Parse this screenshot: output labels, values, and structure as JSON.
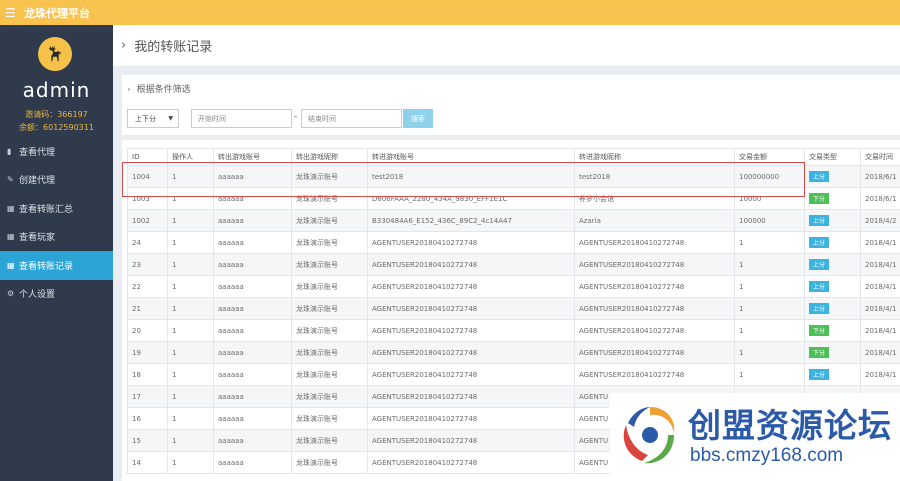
{
  "header": {
    "brand": "龙珠代理平台"
  },
  "sidebar": {
    "username": "admin",
    "invite_code": "邀请码：366197",
    "balance": "余额：6012590311",
    "items": [
      {
        "label": "查看代理",
        "icon": "book-icon",
        "glyph": "▮"
      },
      {
        "label": "创建代理",
        "icon": "edit-icon",
        "glyph": "✎"
      },
      {
        "label": "查看转账汇总",
        "icon": "table-icon",
        "glyph": "▦"
      },
      {
        "label": "查看玩家",
        "icon": "table-icon",
        "glyph": "▦"
      },
      {
        "label": "查看转账记录",
        "icon": "table-icon",
        "glyph": "▦",
        "active": true
      },
      {
        "label": "个人设置",
        "icon": "gear-icon",
        "glyph": "⚙"
      }
    ]
  },
  "page": {
    "title": "我的转账记录"
  },
  "filter": {
    "title": "根据条件筛选",
    "type_selected": "上下分",
    "start_placeholder": "开始时间",
    "separator": "-",
    "end_placeholder": "结束时间",
    "search_label": "搜索"
  },
  "table": {
    "columns": [
      "ID",
      "操作人",
      "转出游戏账号",
      "转出游戏昵称",
      "转进游戏账号",
      "转进游戏昵称",
      "交易金额",
      "交易类型",
      "交易时间"
    ],
    "rows": [
      {
        "id": "1004",
        "operator": "1",
        "from_account": "aaaaaa",
        "from_nick": "龙珠演示账号",
        "to_account": "test2018",
        "to_nick": "test2018",
        "amount": "100000000",
        "type": "上分",
        "time": "2018/6/1"
      },
      {
        "id": "1003",
        "operator": "1",
        "from_account": "aaaaaa",
        "from_nick": "龙珠演示账号",
        "to_account": "D806FAAA_2280_434A_9830_EFF1E1C",
        "to_nick": "养梦小会馆",
        "amount": "10000",
        "type": "下分",
        "time": "2018/6/1"
      },
      {
        "id": "1002",
        "operator": "1",
        "from_account": "aaaaaa",
        "from_nick": "龙珠演示账号",
        "to_account": "B330484A6_E152_436C_89C2_4c14A47",
        "to_nick": "Azaria",
        "amount": "100000",
        "type": "上分",
        "time": "2018/4/2"
      },
      {
        "id": "24",
        "operator": "1",
        "from_account": "aaaaaa",
        "from_nick": "龙珠演示账号",
        "to_account": "AGENTUSER20180410272748",
        "to_nick": "AGENTUSER20180410272748",
        "amount": "1",
        "type": "上分",
        "time": "2018/4/1"
      },
      {
        "id": "23",
        "operator": "1",
        "from_account": "aaaaaa",
        "from_nick": "龙珠演示账号",
        "to_account": "AGENTUSER20180410272748",
        "to_nick": "AGENTUSER20180410272748",
        "amount": "1",
        "type": "上分",
        "time": "2018/4/1"
      },
      {
        "id": "22",
        "operator": "1",
        "from_account": "aaaaaa",
        "from_nick": "龙珠演示账号",
        "to_account": "AGENTUSER20180410272748",
        "to_nick": "AGENTUSER20180410272748",
        "amount": "1",
        "type": "上分",
        "time": "2018/4/1"
      },
      {
        "id": "21",
        "operator": "1",
        "from_account": "aaaaaa",
        "from_nick": "龙珠演示账号",
        "to_account": "AGENTUSER20180410272748",
        "to_nick": "AGENTUSER20180410272748",
        "amount": "1",
        "type": "上分",
        "time": "2018/4/1"
      },
      {
        "id": "20",
        "operator": "1",
        "from_account": "aaaaaa",
        "from_nick": "龙珠演示账号",
        "to_account": "AGENTUSER20180410272748",
        "to_nick": "AGENTUSER20180410272748",
        "amount": "1",
        "type": "下分",
        "time": "2018/4/1"
      },
      {
        "id": "19",
        "operator": "1",
        "from_account": "aaaaaa",
        "from_nick": "龙珠演示账号",
        "to_account": "AGENTUSER20180410272748",
        "to_nick": "AGENTUSER20180410272748",
        "amount": "1",
        "type": "下分",
        "time": "2018/4/1"
      },
      {
        "id": "18",
        "operator": "1",
        "from_account": "aaaaaa",
        "from_nick": "龙珠演示账号",
        "to_account": "AGENTUSER20180410272748",
        "to_nick": "AGENTUSER20180410272748",
        "amount": "1",
        "type": "上分",
        "time": "2018/4/1"
      },
      {
        "id": "17",
        "operator": "1",
        "from_account": "aaaaaa",
        "from_nick": "龙珠演示账号",
        "to_account": "AGENTUSER20180410272748",
        "to_nick": "AGENTU",
        "amount": "",
        "type": "",
        "time": ""
      },
      {
        "id": "16",
        "operator": "1",
        "from_account": "aaaaaa",
        "from_nick": "龙珠演示账号",
        "to_account": "AGENTUSER20180410272748",
        "to_nick": "AGENTU",
        "amount": "",
        "type": "",
        "time": ""
      },
      {
        "id": "15",
        "operator": "1",
        "from_account": "aaaaaa",
        "from_nick": "龙珠演示账号",
        "to_account": "AGENTUSER20180410272748",
        "to_nick": "AGENTU",
        "amount": "",
        "type": "",
        "time": ""
      },
      {
        "id": "14",
        "operator": "1",
        "from_account": "aaaaaa",
        "from_nick": "龙珠演示账号",
        "to_account": "AGENTUSER20180410272748",
        "to_nick": "AGENTU",
        "amount": "",
        "type": "",
        "time": ""
      }
    ]
  },
  "watermark": {
    "title": "创盟资源论坛",
    "url": "bbs.cmzy168.com"
  },
  "colors": {
    "topbar": "#f8c24f",
    "sidebar": "#2f3b4c",
    "active": "#2ca5d6",
    "badge_up": "#3bb4e0",
    "badge_down": "#4cbf59",
    "highlight": "#d94a4a"
  }
}
